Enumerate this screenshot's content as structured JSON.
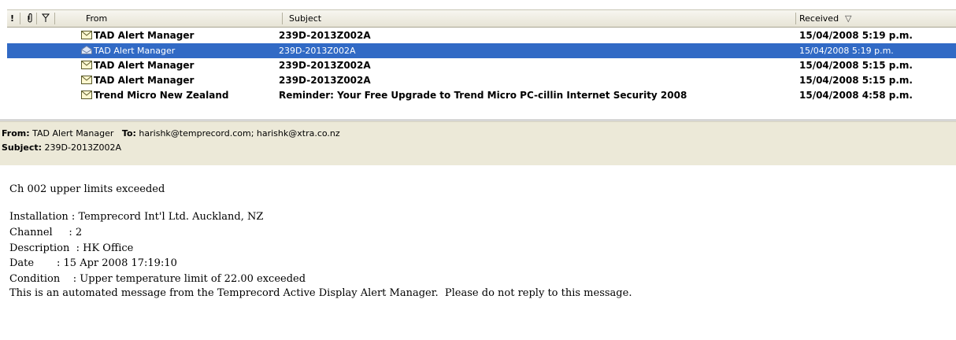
{
  "columns": {
    "importance": "!",
    "attachment": "attachment-icon",
    "flag": "flag-icon",
    "from": "From",
    "subject": "Subject",
    "received": "Received",
    "sort_indicator": "▽"
  },
  "messages": [
    {
      "from": "TAD Alert Manager",
      "subject": "239D-2013Z002A",
      "received": "15/04/2008 5:19 p.m.",
      "unread": true,
      "selected": false
    },
    {
      "from": "TAD Alert Manager",
      "subject": "239D-2013Z002A",
      "received": "15/04/2008 5:19 p.m.",
      "unread": false,
      "selected": true
    },
    {
      "from": "TAD Alert Manager",
      "subject": "239D-2013Z002A",
      "received": "15/04/2008 5:15 p.m.",
      "unread": true,
      "selected": false
    },
    {
      "from": "TAD Alert Manager",
      "subject": "239D-2013Z002A",
      "received": "15/04/2008 5:15 p.m.",
      "unread": true,
      "selected": false
    },
    {
      "from": "Trend Micro New Zealand",
      "subject": "Reminder: Your Free Upgrade to Trend Micro PC-cillin Internet Security 2008",
      "received": "15/04/2008 4:58 p.m.",
      "unread": true,
      "selected": false
    }
  ],
  "preview": {
    "from_label": "From:",
    "from_value": "TAD Alert Manager",
    "to_label": "To:",
    "to_value": "harishk@temprecord.com; harishk@xtra.co.nz",
    "subject_label": "Subject:",
    "subject_value": "239D-2013Z002A"
  },
  "body": {
    "line1": "Ch 002 upper limits exceeded",
    "line2": "Installation : Temprecord Int'l Ltd. Auckland, NZ",
    "line3": "Channel     : 2",
    "line4": "Description  : HK Office",
    "line5": "Date       : 15 Apr 2008 17:19:10",
    "line6": "Condition    : Upper temperature limit of 22.00 exceeded",
    "line7": "This is an automated message from the Temprecord Active Display Alert Manager.  Please do not reply to this message."
  },
  "colors": {
    "selection": "#316ac5",
    "header_bg": "#ece9d8"
  }
}
